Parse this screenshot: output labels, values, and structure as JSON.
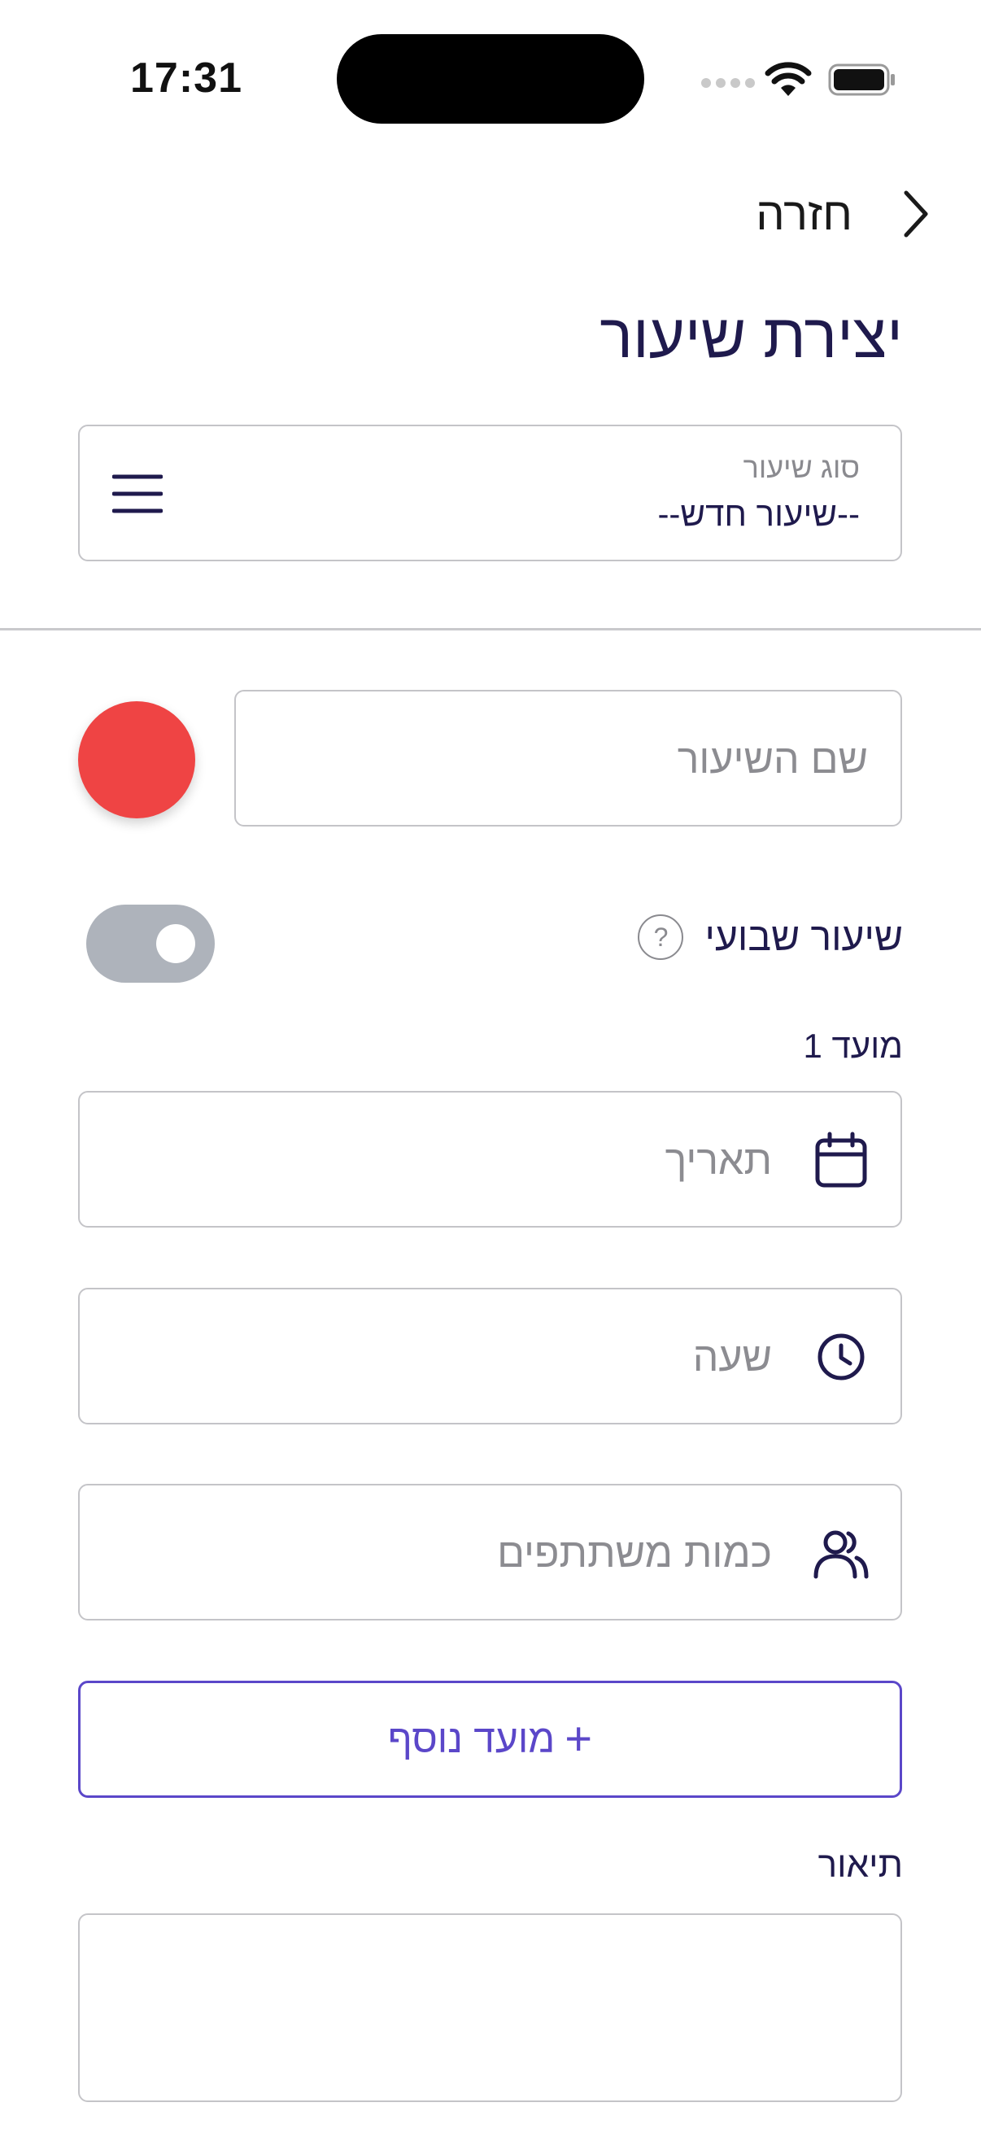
{
  "status_bar": {
    "time": "17:31"
  },
  "header": {
    "back_label": "חזרה",
    "title": "יצירת שיעור"
  },
  "lesson_type": {
    "label": "סוג שיעור",
    "value": "--שיעור חדש--"
  },
  "lesson_name": {
    "placeholder": "שם השיעור",
    "color": "#ef4444"
  },
  "weekly": {
    "label": "שיעור שבועי",
    "help": "?",
    "enabled": false
  },
  "session": {
    "label": "מועד 1",
    "date_placeholder": "תאריך",
    "time_placeholder": "שעה",
    "participants_placeholder": "כמות משתתפים"
  },
  "add_session": {
    "plus": "+",
    "label": "מועד נוסף"
  },
  "description": {
    "label": "תיאור",
    "value": ""
  },
  "colors": {
    "accent": "#5b47c9",
    "primary_text": "#1f1a4d",
    "toggle_off": "#aeb3bb"
  }
}
